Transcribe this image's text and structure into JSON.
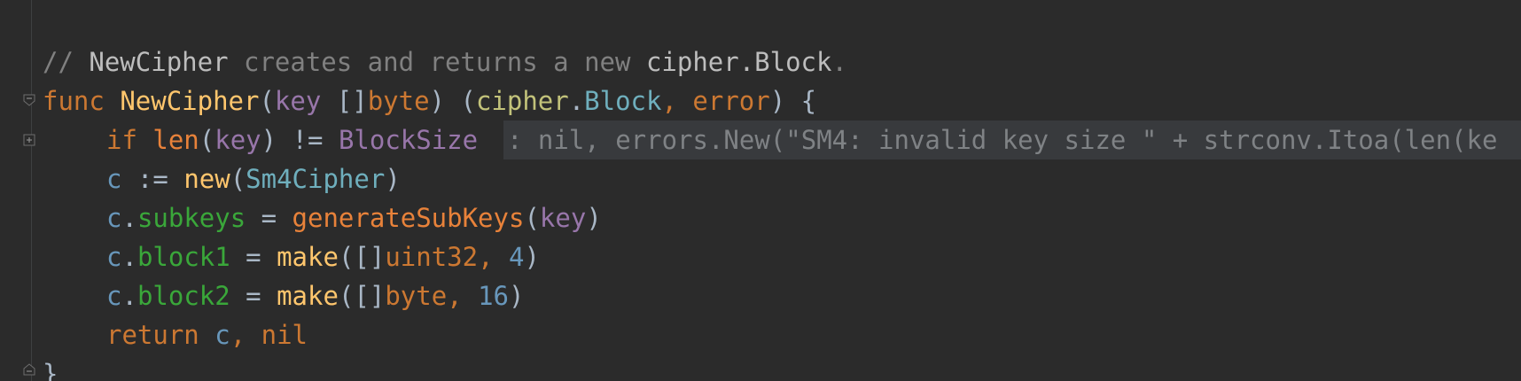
{
  "editor": {
    "line1": {
      "slash": "// ",
      "ref_name": "NewCipher",
      "text_mid": " creates and returns a new ",
      "ref_type": "cipher.Block",
      "text_end": "."
    },
    "line2": {
      "kw_func": "func",
      "fn_name": "NewCipher",
      "open_paren": "(",
      "param": "key",
      "slice": " []",
      "type_byte": "byte",
      "close_sig": ") (",
      "pkg": "cipher",
      "dot": ".",
      "iface": "Block",
      "comma": ", ",
      "type_error": "error",
      "close_ret": ") {"
    },
    "line3": {
      "kw_if": "if",
      "fn_len": "len",
      "open": "(",
      "arg": "key",
      "op": ") != ",
      "const": "BlockSize",
      "inlay": ": nil, errors.New(\"SM4: invalid key size \" + strconv.Itoa(len(ke"
    },
    "line4": {
      "var": "c",
      "assign": " := ",
      "fn_new": "new",
      "open": "(",
      "type": "Sm4Cipher",
      "close": ")"
    },
    "line5": {
      "var": "c",
      "dot": ".",
      "field": "subkeys",
      "eq": " = ",
      "call": "generateSubKeys",
      "open": "(",
      "arg": "key",
      "close": ")"
    },
    "line6": {
      "var": "c",
      "dot": ".",
      "field": "block1",
      "eq": " = ",
      "fn_make": "make",
      "open": "([]",
      "type": "uint32",
      "comma": ", ",
      "num": "4",
      "close": ")"
    },
    "line7": {
      "var": "c",
      "dot": ".",
      "field": "block2",
      "eq": " = ",
      "fn_make": "make",
      "open": "([]",
      "type": "byte",
      "comma": ", ",
      "num": "16",
      "close": ")"
    },
    "line8": {
      "kw_return": "return",
      "sp": " ",
      "var": "c",
      "comma": ", ",
      "nil": "nil"
    },
    "line9": {
      "brace": "}"
    }
  },
  "icons": {
    "fold_collapse": "fold-collapse-icon",
    "fold_expand": "fold-expand-icon",
    "fold_end": "fold-end-icon"
  }
}
